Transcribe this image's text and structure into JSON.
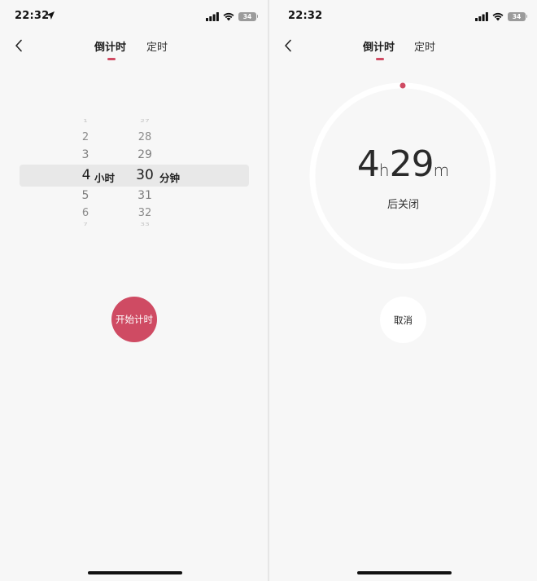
{
  "colors": {
    "accent": "#cf4b63",
    "background": "#f7f7f7",
    "ring": "#ffffff"
  },
  "left": {
    "status": {
      "time": "22:32",
      "battery": "34"
    },
    "tabs": [
      {
        "label": "倒计时",
        "active": true
      },
      {
        "label": "定时",
        "active": false
      }
    ],
    "picker": {
      "hours": {
        "above": [
          "1",
          "2",
          "3"
        ],
        "selected": "4",
        "below": [
          "5",
          "6",
          "7"
        ],
        "unit": "小时"
      },
      "minutes": {
        "above": [
          "27",
          "28",
          "29"
        ],
        "selected": "30",
        "below": [
          "31",
          "32",
          "33"
        ],
        "unit": "分钟"
      }
    },
    "start_label": "开始计时"
  },
  "right": {
    "status": {
      "time": "22:32",
      "battery": "34"
    },
    "tabs": [
      {
        "label": "倒计时",
        "active": true
      },
      {
        "label": "定时",
        "active": false
      }
    ],
    "countdown": {
      "hours": "4",
      "hours_unit": "h",
      "minutes": "29",
      "minutes_unit": "m",
      "label": "后关闭",
      "progress": 0.0
    },
    "cancel_label": "取消"
  }
}
